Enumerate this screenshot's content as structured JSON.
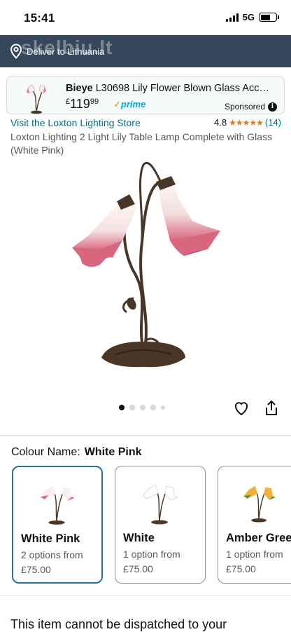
{
  "status": {
    "time": "15:41",
    "network": "5G"
  },
  "deliver": {
    "label": "Deliver to Lithuania",
    "watermark": "skelbiu.lt",
    "icon": "location-pin-icon"
  },
  "ad": {
    "brand": "Bieye",
    "title_rest": " L30698 Lily Flower Blown Glass Acc…",
    "currency": "£",
    "price_whole": "119",
    "price_cents": "99",
    "prime_label": "prime",
    "sponsored_label": "Sponsored"
  },
  "product": {
    "store_link": "Visit the Loxton Lighting Store",
    "rating": "4.8",
    "stars": "★★★★★",
    "rating_count": "(14)",
    "title": "Loxton Lighting 2 Light Lily Table Lamp Complete with Glass (White Pink)"
  },
  "colour": {
    "label": "Colour Name:",
    "selected": "White Pink",
    "options": [
      {
        "name": "White Pink",
        "options_text": "2 options from",
        "price": "£75.00",
        "shade_top": "#fbeef2",
        "shade_bottom": "#d9667f"
      },
      {
        "name": "White",
        "options_text": "1 option from",
        "price": "£75.00",
        "shade_top": "#ffffff",
        "shade_bottom": "#efe6d8"
      },
      {
        "name": "Amber Green",
        "options_text": "1 option from",
        "price": "£75.00",
        "shade_top": "#f2b13a",
        "shade_bottom": "#4f9a2c"
      }
    ]
  },
  "dispatch": {
    "text": "This item cannot be dispatched to your"
  },
  "colors": {
    "nav_bar": "#37475a",
    "link": "#007185",
    "star": "#de7921",
    "selected_border": "#2b6f9c",
    "prime": "#00a8e1"
  }
}
